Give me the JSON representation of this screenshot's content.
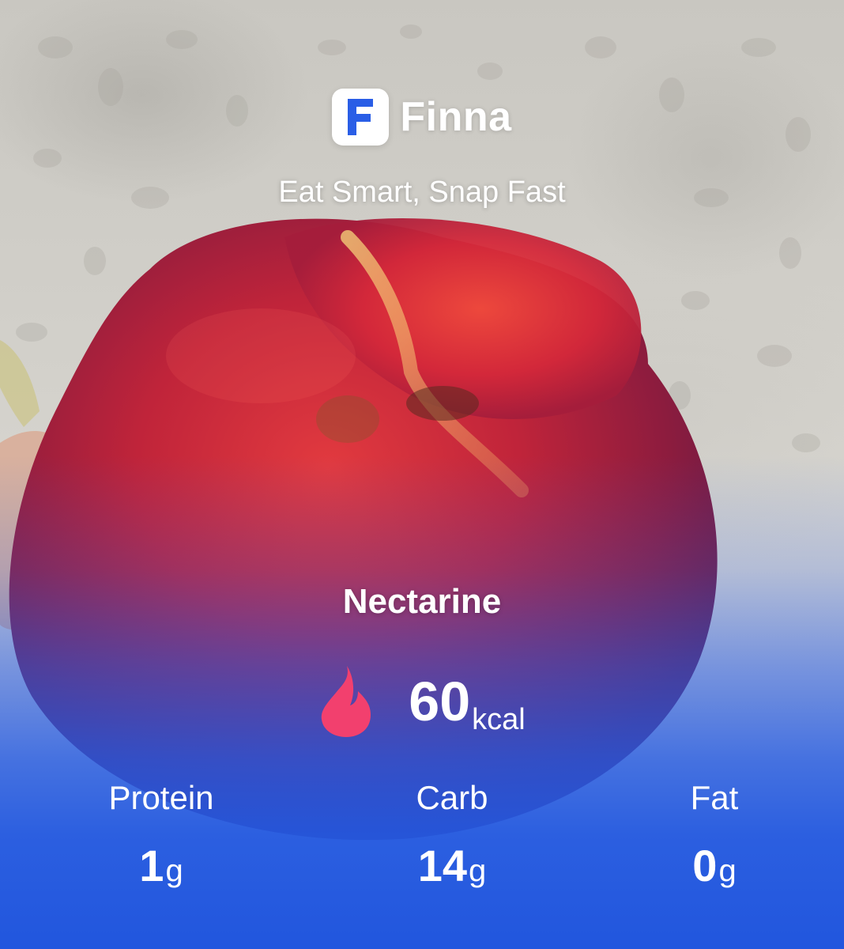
{
  "app": {
    "name": "Finna",
    "logo_letter": "F",
    "tagline": "Eat Smart, Snap Fast"
  },
  "food": {
    "name": "Nectarine",
    "calories_value": "60",
    "calories_unit": "kcal",
    "calorie_icon": "flame-icon"
  },
  "macros": {
    "protein": {
      "label": "Protein",
      "value": "1",
      "unit": "g"
    },
    "carb": {
      "label": "Carb",
      "value": "14",
      "unit": "g"
    },
    "fat": {
      "label": "Fat",
      "value": "0",
      "unit": "g"
    }
  },
  "colors": {
    "brand_blue": "#2a5ee6",
    "flame": "#f2406e",
    "fruit_red": "#c8243b"
  }
}
